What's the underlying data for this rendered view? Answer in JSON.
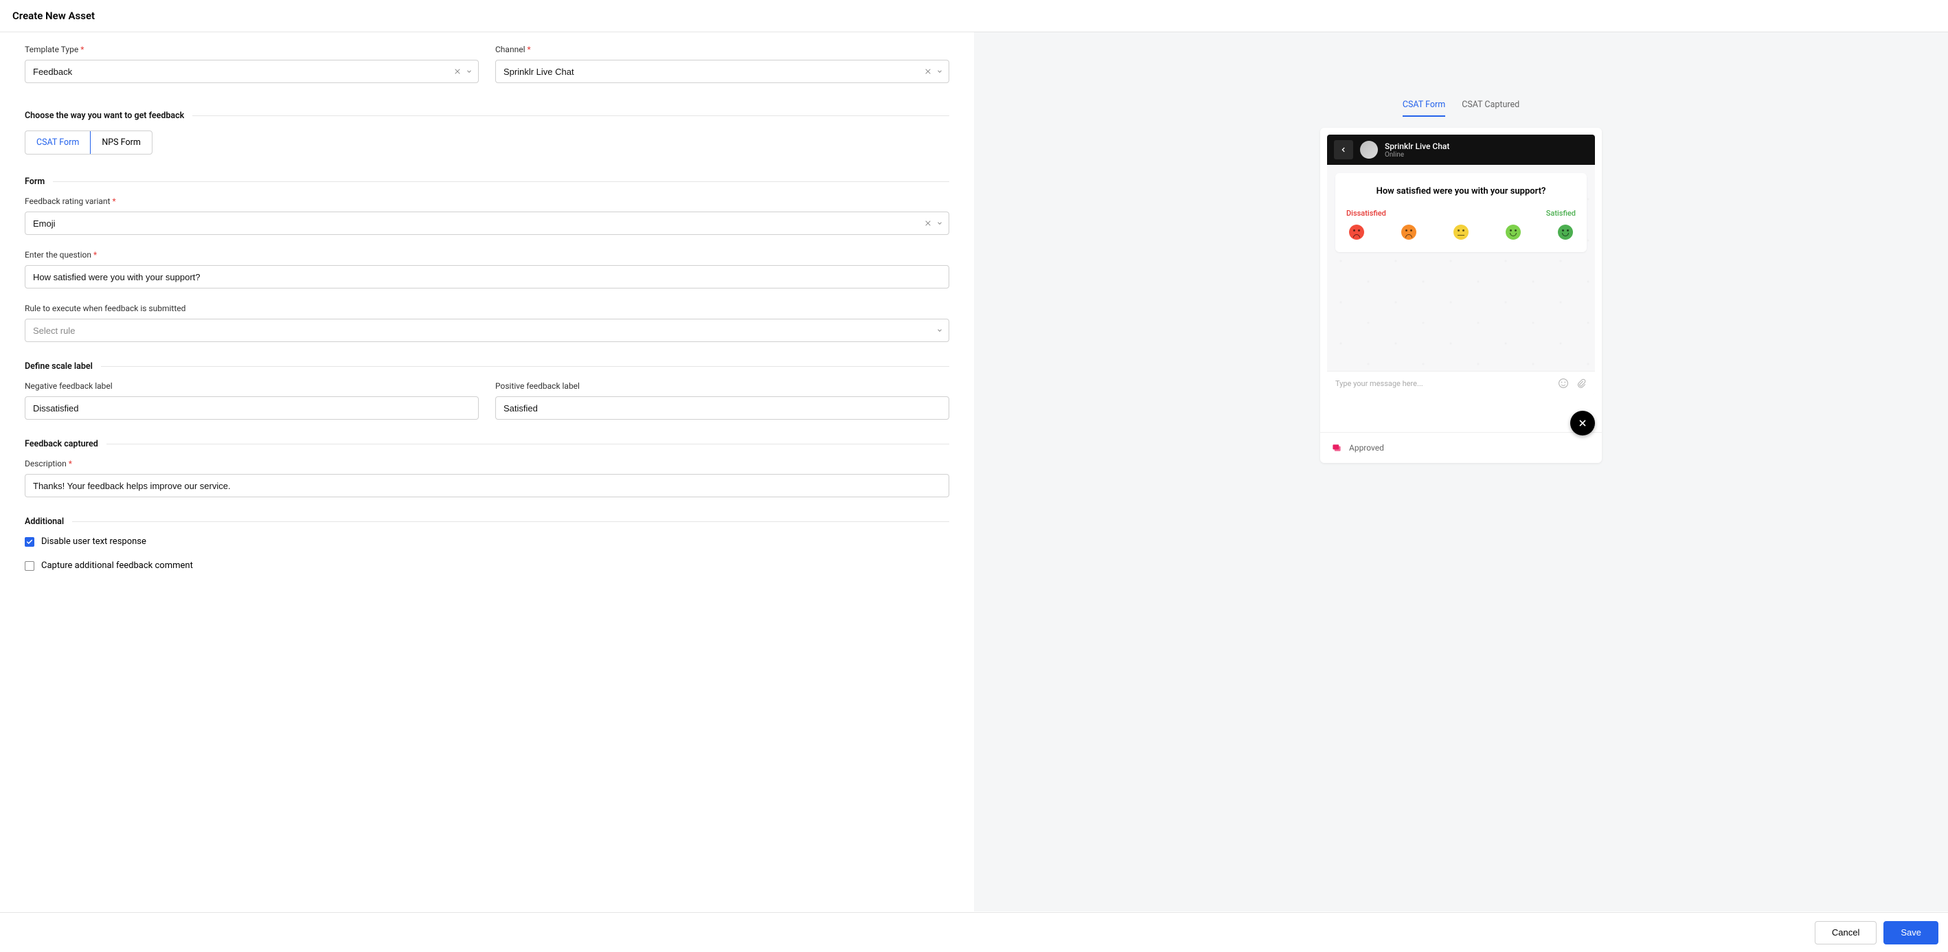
{
  "header": {
    "title": "Create New Asset"
  },
  "form": {
    "template_type": {
      "label": "Template Type",
      "value": "Feedback"
    },
    "channel": {
      "label": "Channel",
      "value": "Sprinklr Live Chat"
    },
    "feedback_method": {
      "label": "Choose the way you want to get feedback",
      "tabs": {
        "csat": "CSAT Form",
        "nps": "NPS Form"
      }
    },
    "form_section": {
      "label": "Form",
      "rating_variant": {
        "label": "Feedback rating variant",
        "value": "Emoji"
      },
      "question": {
        "label": "Enter the question",
        "value": "How satisfied were you with your support?"
      },
      "rule": {
        "label": "Rule to execute when feedback is submitted",
        "placeholder": "Select rule"
      }
    },
    "scale": {
      "label": "Define scale label",
      "negative": {
        "label": "Negative feedback label",
        "value": "Dissatisfied"
      },
      "positive": {
        "label": "Positive feedback label",
        "value": "Satisfied"
      }
    },
    "captured": {
      "label": "Feedback captured",
      "description": {
        "label": "Description",
        "value": "Thanks! Your feedback helps improve our service."
      }
    },
    "additional": {
      "label": "Additional",
      "disable_text": {
        "label": "Disable user text response",
        "checked": true
      },
      "capture_comment": {
        "label": "Capture additional feedback comment",
        "checked": false
      }
    }
  },
  "preview": {
    "tabs": {
      "form": "CSAT Form",
      "captured": "CSAT Captured"
    },
    "chat": {
      "title": "Sprinklr Live Chat",
      "status": "Online",
      "question": "How satisfied were you with your support?",
      "neg_label": "Dissatisfied",
      "pos_label": "Satisfied",
      "input_placeholder": "Type your message here..."
    },
    "approved_label": "Approved"
  },
  "footer": {
    "cancel": "Cancel",
    "save": "Save"
  }
}
